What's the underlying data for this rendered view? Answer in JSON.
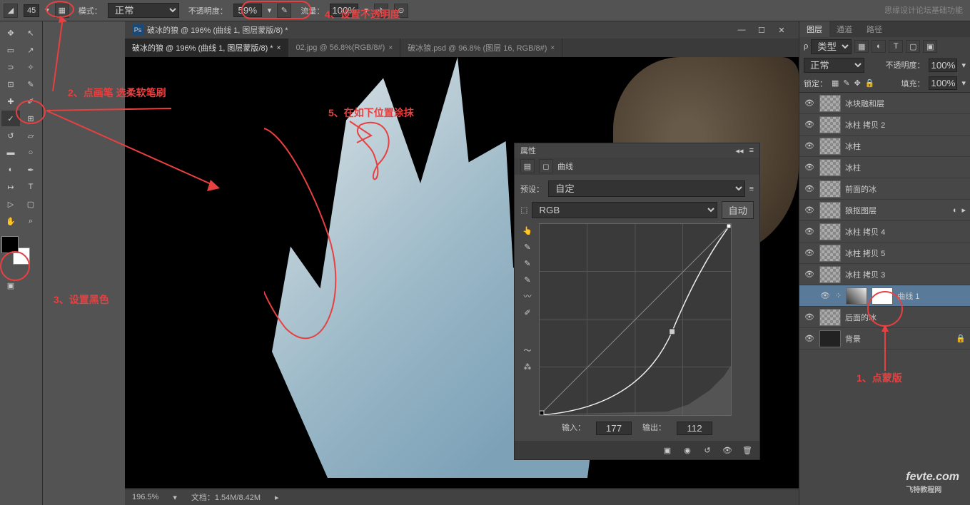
{
  "options": {
    "brush_size": "45",
    "mode_label": "模式：",
    "mode_value": "正常",
    "opacity_label": "不透明度：",
    "opacity_value": "59%",
    "flow_label": "流量：",
    "flow_value": "100%"
  },
  "watermark_top": "思缘设计论坛基础功能",
  "watermark_bottom": "fevte.com",
  "watermark_bottom_sub": "飞特教程网",
  "doc": {
    "titlebar": "破冰的狼 @ 196% (曲线 1, 图层蒙版/8) *",
    "tabs": [
      {
        "label": "破冰的狼 @ 196% (曲线 1, 图层蒙版/8) *",
        "active": true
      },
      {
        "label": "02.jpg @ 56.8%(RGB/8#)",
        "active": false
      },
      {
        "label": "破冰狼.psd @ 96.8% (图层 16, RGB/8#)",
        "active": false
      }
    ],
    "status_zoom": "196.5%",
    "status_doc": "文档：1.54M/8.42M"
  },
  "curves": {
    "panel_title": "属性",
    "subtitle": "曲线",
    "preset_label": "预设：",
    "preset_value": "自定",
    "channel_value": "RGB",
    "auto_btn": "自动",
    "input_label": "输入：",
    "input_value": "177",
    "output_label": "输出：",
    "output_value": "112"
  },
  "layers_panel": {
    "tabs": [
      "图层",
      "通道",
      "路径"
    ],
    "filter_label": "类型",
    "blend_mode": "正常",
    "opacity_label": "不透明度：",
    "opacity_value": "100%",
    "lock_label": "锁定：",
    "fill_label": "填充：",
    "fill_value": "100%",
    "layers": [
      {
        "name": "冰块融和层",
        "visible": true
      },
      {
        "name": "冰柱 拷贝 2",
        "visible": true
      },
      {
        "name": "冰柱",
        "visible": true
      },
      {
        "name": "冰柱",
        "visible": true
      },
      {
        "name": "前面的冰",
        "visible": true
      },
      {
        "name": "狼抠图层",
        "visible": true,
        "fx": true
      },
      {
        "name": "冰柱 拷贝 4",
        "visible": true
      },
      {
        "name": "冰柱 拷贝 5",
        "visible": true
      },
      {
        "name": "冰柱 拷贝 3",
        "visible": true
      },
      {
        "name": "曲线 1",
        "visible": true,
        "selected": true,
        "indented": true,
        "adjustment": true
      },
      {
        "name": "后面的冰",
        "visible": true
      },
      {
        "name": "背景",
        "visible": true,
        "locked": true,
        "bg": true
      }
    ]
  },
  "annotations": {
    "a1": "1、点蒙版",
    "a2": "2、点画笔 选柔软笔刷",
    "a3": "3、设置黑色",
    "a4": "4、设置不透明度",
    "a5": "5、在如下位置涂抹"
  }
}
